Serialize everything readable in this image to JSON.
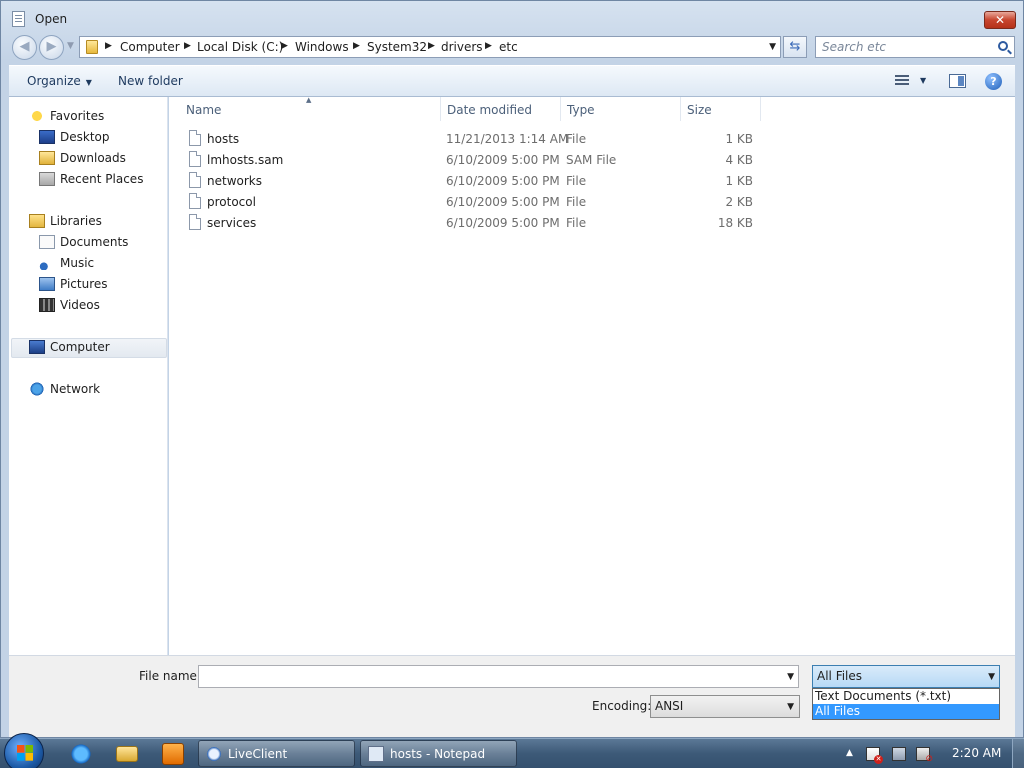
{
  "dialog": {
    "title": "Open",
    "close_glyph": "✕"
  },
  "address_bar": {
    "crumbs": [
      "Computer",
      "Local Disk (C:)",
      "Windows",
      "System32",
      "drivers",
      "etc"
    ]
  },
  "search": {
    "placeholder": "Search etc"
  },
  "toolbar": {
    "organize_label": "Organize",
    "new_folder_label": "New folder",
    "help_glyph": "?"
  },
  "sidebar": {
    "favorites": {
      "label": "Favorites",
      "items": [
        {
          "label": "Desktop",
          "icon": "desktop-icon"
        },
        {
          "label": "Downloads",
          "icon": "downloads-icon"
        },
        {
          "label": "Recent Places",
          "icon": "recent-places-icon"
        }
      ]
    },
    "libraries": {
      "label": "Libraries",
      "items": [
        {
          "label": "Documents",
          "icon": "documents-icon"
        },
        {
          "label": "Music",
          "icon": "music-icon"
        },
        {
          "label": "Pictures",
          "icon": "pictures-icon"
        },
        {
          "label": "Videos",
          "icon": "videos-icon"
        }
      ]
    },
    "computer": {
      "label": "Computer",
      "selected": true
    },
    "network": {
      "label": "Network"
    }
  },
  "file_list": {
    "columns": [
      "Name",
      "Date modified",
      "Type",
      "Size"
    ],
    "sorted_by": "Name",
    "rows": [
      {
        "name": "hosts",
        "date": "11/21/2013 1:14 AM",
        "type": "File",
        "size": "1 KB"
      },
      {
        "name": "lmhosts.sam",
        "date": "6/10/2009 5:00 PM",
        "type": "SAM File",
        "size": "4 KB"
      },
      {
        "name": "networks",
        "date": "6/10/2009 5:00 PM",
        "type": "File",
        "size": "1 KB"
      },
      {
        "name": "protocol",
        "date": "6/10/2009 5:00 PM",
        "type": "File",
        "size": "2 KB"
      },
      {
        "name": "services",
        "date": "6/10/2009 5:00 PM",
        "type": "File",
        "size": "18 KB"
      }
    ]
  },
  "bottom": {
    "filename_label": "File name:",
    "filename_value": "",
    "filetype_value": "All Files",
    "filetype_options": [
      {
        "label": "Text Documents (*.txt)",
        "selected": false
      },
      {
        "label": "All Files",
        "selected": true
      }
    ],
    "encoding_label": "Encoding:",
    "encoding_value": "ANSI"
  },
  "taskbar": {
    "tasks": [
      {
        "label": "LiveClient",
        "icon": "liveclient-icon"
      },
      {
        "label": "hosts - Notepad",
        "icon": "notepad-icon"
      }
    ],
    "pinned": [
      "internet-explorer-icon",
      "windows-explorer-icon",
      "media-player-icon"
    ],
    "clock": "2:20 AM"
  },
  "colors": {
    "selection": "#3399ff",
    "close_button": "#c7452e",
    "taskbar": "#3d5a78"
  }
}
